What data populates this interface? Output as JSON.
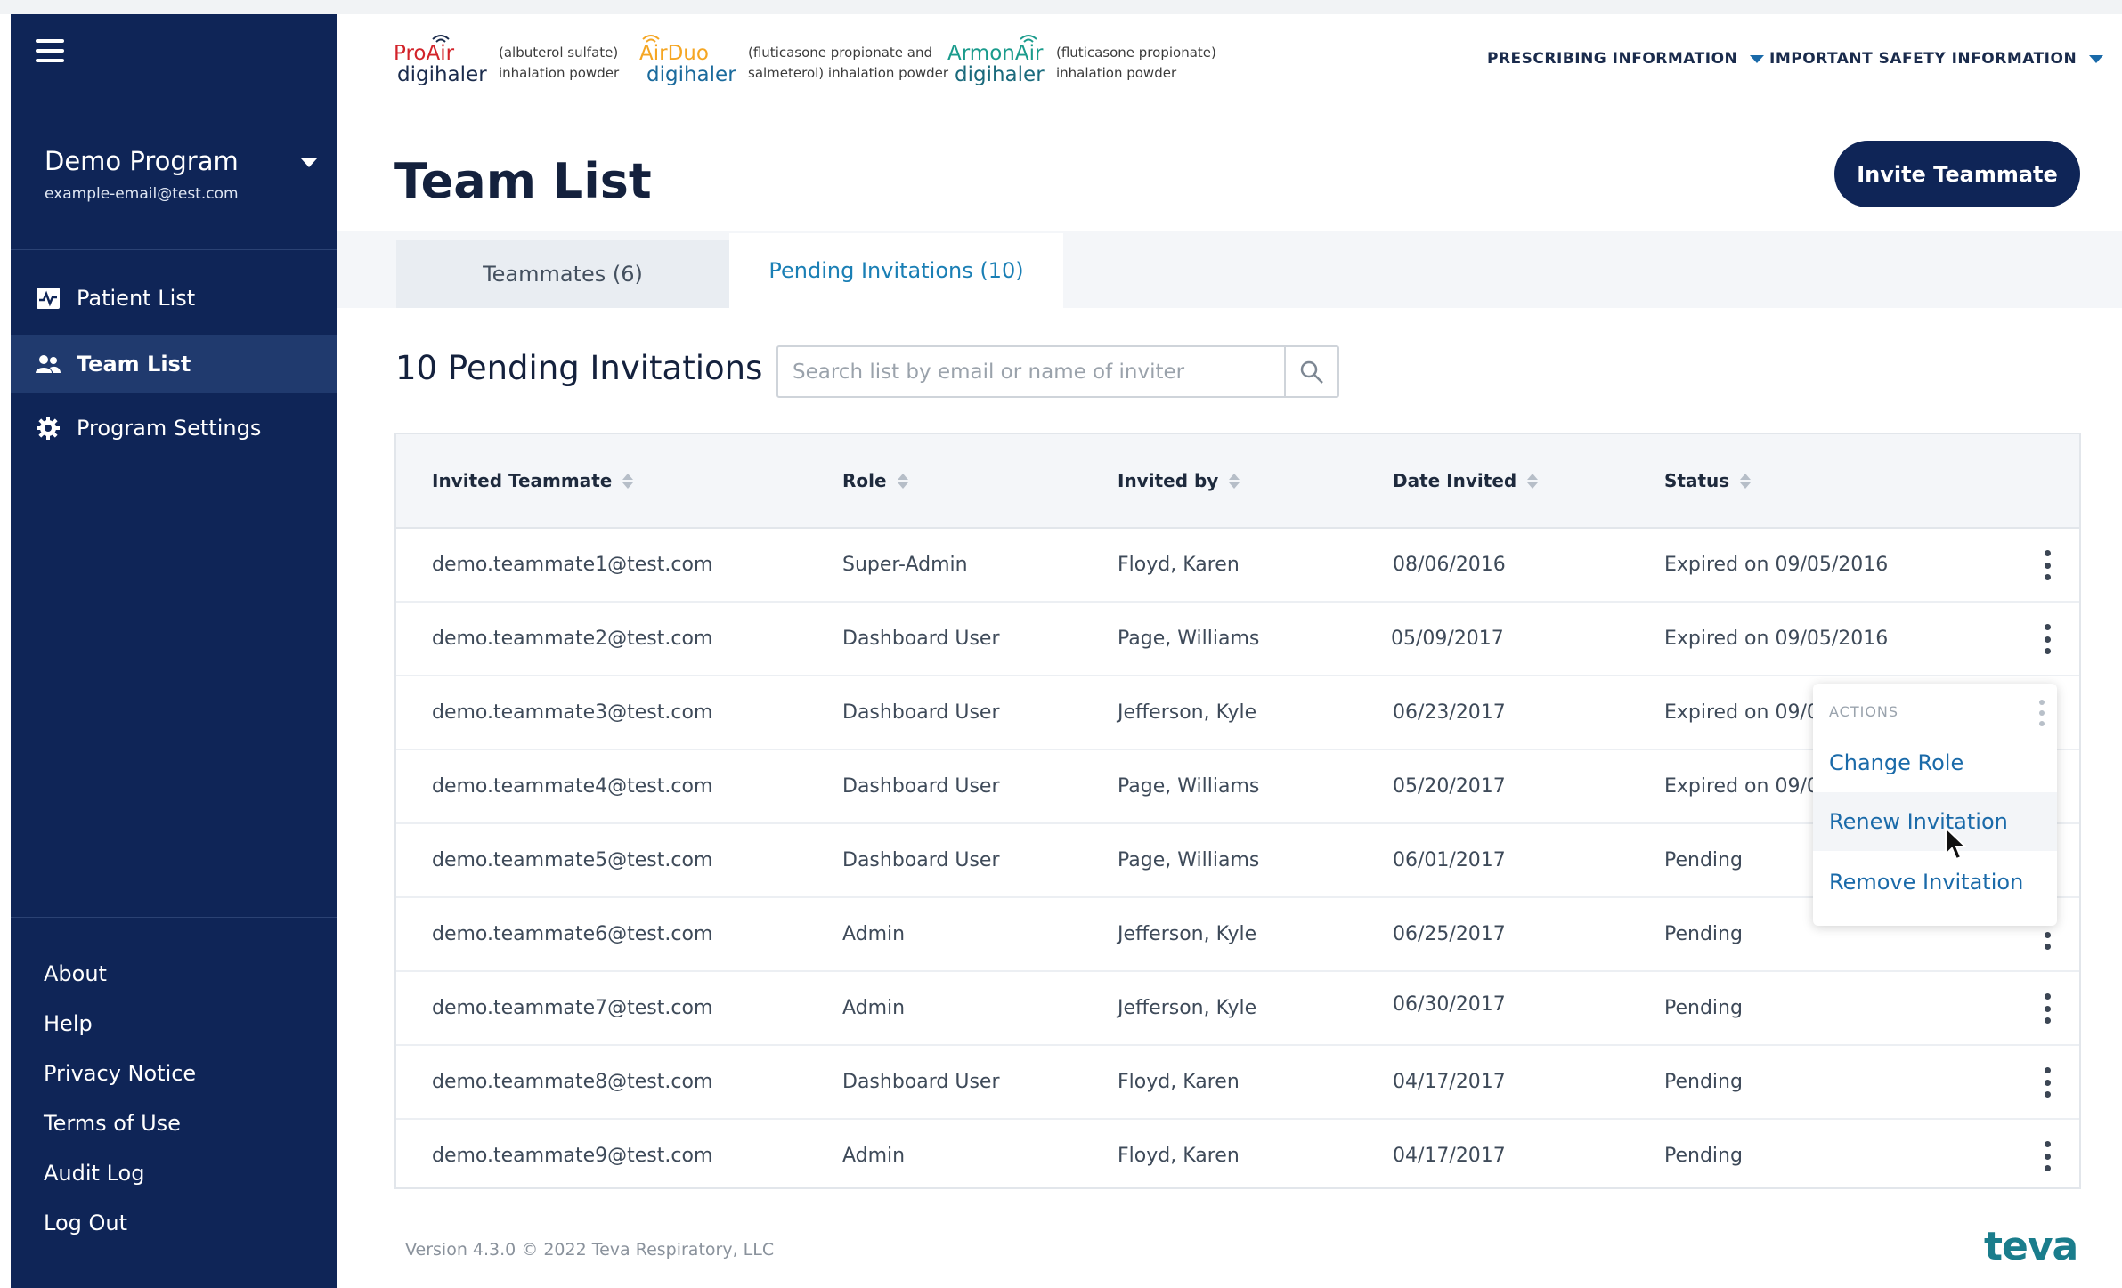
{
  "sidebar": {
    "program_name": "Demo Program",
    "program_email": "example-email@test.com",
    "nav": [
      {
        "label": "Patient List",
        "icon": "chart-icon"
      },
      {
        "label": "Team List",
        "icon": "users-icon",
        "active": true
      },
      {
        "label": "Program Settings",
        "icon": "gear-icon"
      }
    ],
    "footer": [
      "About",
      "Help",
      "Privacy Notice",
      "Terms of Use",
      "Audit Log",
      "Log Out"
    ]
  },
  "brands": [
    {
      "name_top": "ProAir",
      "name_bottom": "digihaler",
      "desc_1": "(albuterol sulfate)",
      "desc_2": "inhalation powder",
      "color": "#d2232a"
    },
    {
      "name_top": "AirDuo",
      "name_bottom": "digihaler",
      "desc_1": "(fluticasone propionate and",
      "desc_2": "salmeterol) inhalation powder",
      "color": "#f5a623"
    },
    {
      "name_top": "ArmonAir",
      "name_bottom": "digihaler",
      "desc_1": "(fluticasone propionate)",
      "desc_2": "inhalation powder",
      "color": "#1a9b8c"
    }
  ],
  "header": {
    "prescribing": "PRESCRIBING INFORMATION",
    "safety": "IMPORTANT SAFETY INFORMATION",
    "title": "Team List",
    "invite_button": "Invite Teammate"
  },
  "tabs": [
    {
      "label": "Teammates (6)"
    },
    {
      "label": "Pending Invitations (10)",
      "active": true
    }
  ],
  "section": {
    "title": "10 Pending Invitations",
    "search_placeholder": "Search list by email or name of inviter"
  },
  "table": {
    "columns": [
      "Invited Teammate",
      "Role",
      "Invited by",
      "Date Invited",
      "Status"
    ],
    "rows": [
      {
        "email": "demo.teammate1@test.com",
        "role": "Super-Admin",
        "invited_by": "Floyd, Karen",
        "date": "08/06/2016",
        "status": "Expired on 09/05/2016"
      },
      {
        "email": "demo.teammate2@test.com",
        "role": "Dashboard User",
        "invited_by": "Page, Williams",
        "date": "05/09/2017",
        "status": "Expired on 09/05/2016"
      },
      {
        "email": "demo.teammate3@test.com",
        "role": "Dashboard User",
        "invited_by": "Jefferson, Kyle",
        "date": "06/23/2017",
        "status": "Expired on 09/05"
      },
      {
        "email": "demo.teammate4@test.com",
        "role": "Dashboard User",
        "invited_by": "Page, Williams",
        "date": "05/20/2017",
        "status": "Expired on 09/05"
      },
      {
        "email": "demo.teammate5@test.com",
        "role": "Dashboard User",
        "invited_by": "Page, Williams",
        "date": "06/01/2017",
        "status": "Pending"
      },
      {
        "email": "demo.teammate6@test.com",
        "role": "Admin",
        "invited_by": "Jefferson, Kyle",
        "date": "06/25/2017",
        "status": "Pending"
      },
      {
        "email": "demo.teammate7@test.com",
        "role": "Admin",
        "invited_by": "Jefferson, Kyle",
        "date": "06/30/2017",
        "status": "Pending"
      },
      {
        "email": "demo.teammate8@test.com",
        "role": "Dashboard User",
        "invited_by": "Floyd, Karen",
        "date": "04/17/2017",
        "status": "Pending"
      },
      {
        "email": "demo.teammate9@test.com",
        "role": "Admin",
        "invited_by": "Floyd, Karen",
        "date": "04/17/2017",
        "status": "Pending"
      }
    ]
  },
  "actions_menu": {
    "heading": "ACTIONS",
    "items": [
      "Change Role",
      "Renew Invitation",
      "Remove Invitation"
    ],
    "hovered": "Renew Invitation"
  },
  "footer": {
    "version": "Version 4.3.0 © 2022 Teva Respiratory, LLC",
    "logo": "teva"
  },
  "colors": {
    "sidebar": "#0f2557",
    "accent": "#1a7fb5",
    "button": "#0f2557"
  }
}
